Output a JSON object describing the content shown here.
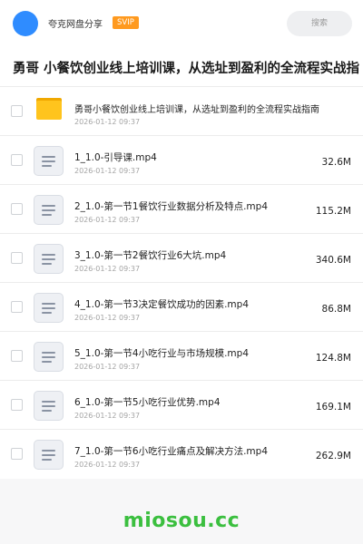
{
  "header": {
    "app_name": "夸克网盘分享",
    "badge": "SVIP",
    "search_placeholder": "搜索"
  },
  "share": {
    "title": "勇哥 小餐饮创业线上培训课，从选址到盈利的全流程实战指"
  },
  "items": [
    {
      "type": "folder",
      "name": "勇哥小餐饮创业线上培训课，从选址到盈利的全流程实战指南",
      "date": "2026-01-12 09:37",
      "size": ""
    },
    {
      "type": "file",
      "name": "1_1.0-引导课.mp4",
      "date": "2026-01-12 09:37",
      "size": "32.6M"
    },
    {
      "type": "file",
      "name": "2_1.0-第一节1餐饮行业数据分析及特点.mp4",
      "date": "2026-01-12 09:37",
      "size": "115.2M"
    },
    {
      "type": "file",
      "name": "3_1.0-第一节2餐饮行业6大坑.mp4",
      "date": "2026-01-12 09:37",
      "size": "340.6M"
    },
    {
      "type": "file",
      "name": "4_1.0-第一节3决定餐饮成功的因素.mp4",
      "date": "2026-01-12 09:37",
      "size": "86.8M"
    },
    {
      "type": "file",
      "name": "5_1.0-第一节4小吃行业与市场规模.mp4",
      "date": "2026-01-12 09:37",
      "size": "124.8M"
    },
    {
      "type": "file",
      "name": "6_1.0-第一节5小吃行业优势.mp4",
      "date": "2026-01-12 09:37",
      "size": "169.1M"
    },
    {
      "type": "file",
      "name": "7_1.0-第一节6小吃行业痛点及解决方法.mp4",
      "date": "2026-01-12 09:37",
      "size": "262.9M"
    }
  ],
  "watermark": "miosou.cc",
  "colors": {
    "accent": "#2f8cff",
    "badge": "#ff9a1f",
    "folder": "#ffc41d",
    "watermark": "#3bbf3f"
  }
}
